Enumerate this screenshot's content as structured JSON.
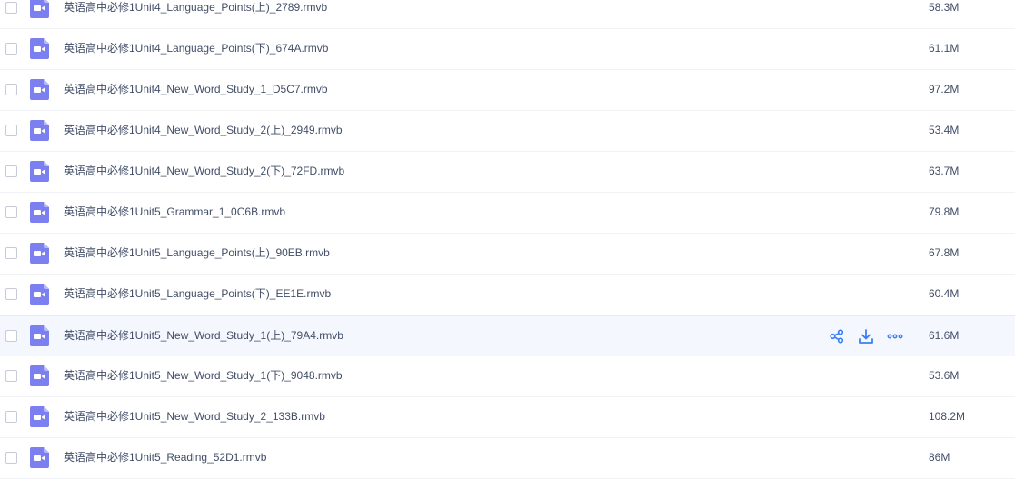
{
  "colors": {
    "accent": "#3b7ff5",
    "video_icon": "#7b7ff0",
    "text": "#424e67",
    "hover_row": "#f4f7fe"
  },
  "row_actions": {
    "share_icon": "share-icon",
    "download_icon": "download-icon",
    "more_icon": "more-icon"
  },
  "files": [
    {
      "name": "英语高中必修1Unit4_Language_Points(上)_2789.rmvb",
      "size": "58.3M",
      "icon": "video-file-icon",
      "hovered": false
    },
    {
      "name": "英语高中必修1Unit4_Language_Points(下)_674A.rmvb",
      "size": "61.1M",
      "icon": "video-file-icon",
      "hovered": false
    },
    {
      "name": "英语高中必修1Unit4_New_Word_Study_1_D5C7.rmvb",
      "size": "97.2M",
      "icon": "video-file-icon",
      "hovered": false
    },
    {
      "name": "英语高中必修1Unit4_New_Word_Study_2(上)_2949.rmvb",
      "size": "53.4M",
      "icon": "video-file-icon",
      "hovered": false
    },
    {
      "name": "英语高中必修1Unit4_New_Word_Study_2(下)_72FD.rmvb",
      "size": "63.7M",
      "icon": "video-file-icon",
      "hovered": false
    },
    {
      "name": "英语高中必修1Unit5_Grammar_1_0C6B.rmvb",
      "size": "79.8M",
      "icon": "video-file-icon",
      "hovered": false
    },
    {
      "name": "英语高中必修1Unit5_Language_Points(上)_90EB.rmvb",
      "size": "67.8M",
      "icon": "video-file-icon",
      "hovered": false
    },
    {
      "name": "英语高中必修1Unit5_Language_Points(下)_EE1E.rmvb",
      "size": "60.4M",
      "icon": "video-file-icon",
      "hovered": false
    },
    {
      "name": "英语高中必修1Unit5_New_Word_Study_1(上)_79A4.rmvb",
      "size": "61.6M",
      "icon": "video-file-icon",
      "hovered": true
    },
    {
      "name": "英语高中必修1Unit5_New_Word_Study_1(下)_9048.rmvb",
      "size": "53.6M",
      "icon": "video-file-icon",
      "hovered": false
    },
    {
      "name": "英语高中必修1Unit5_New_Word_Study_2_133B.rmvb",
      "size": "108.2M",
      "icon": "video-file-icon",
      "hovered": false
    },
    {
      "name": "英语高中必修1Unit5_Reading_52D1.rmvb",
      "size": "86M",
      "icon": "video-file-icon",
      "hovered": false
    }
  ]
}
